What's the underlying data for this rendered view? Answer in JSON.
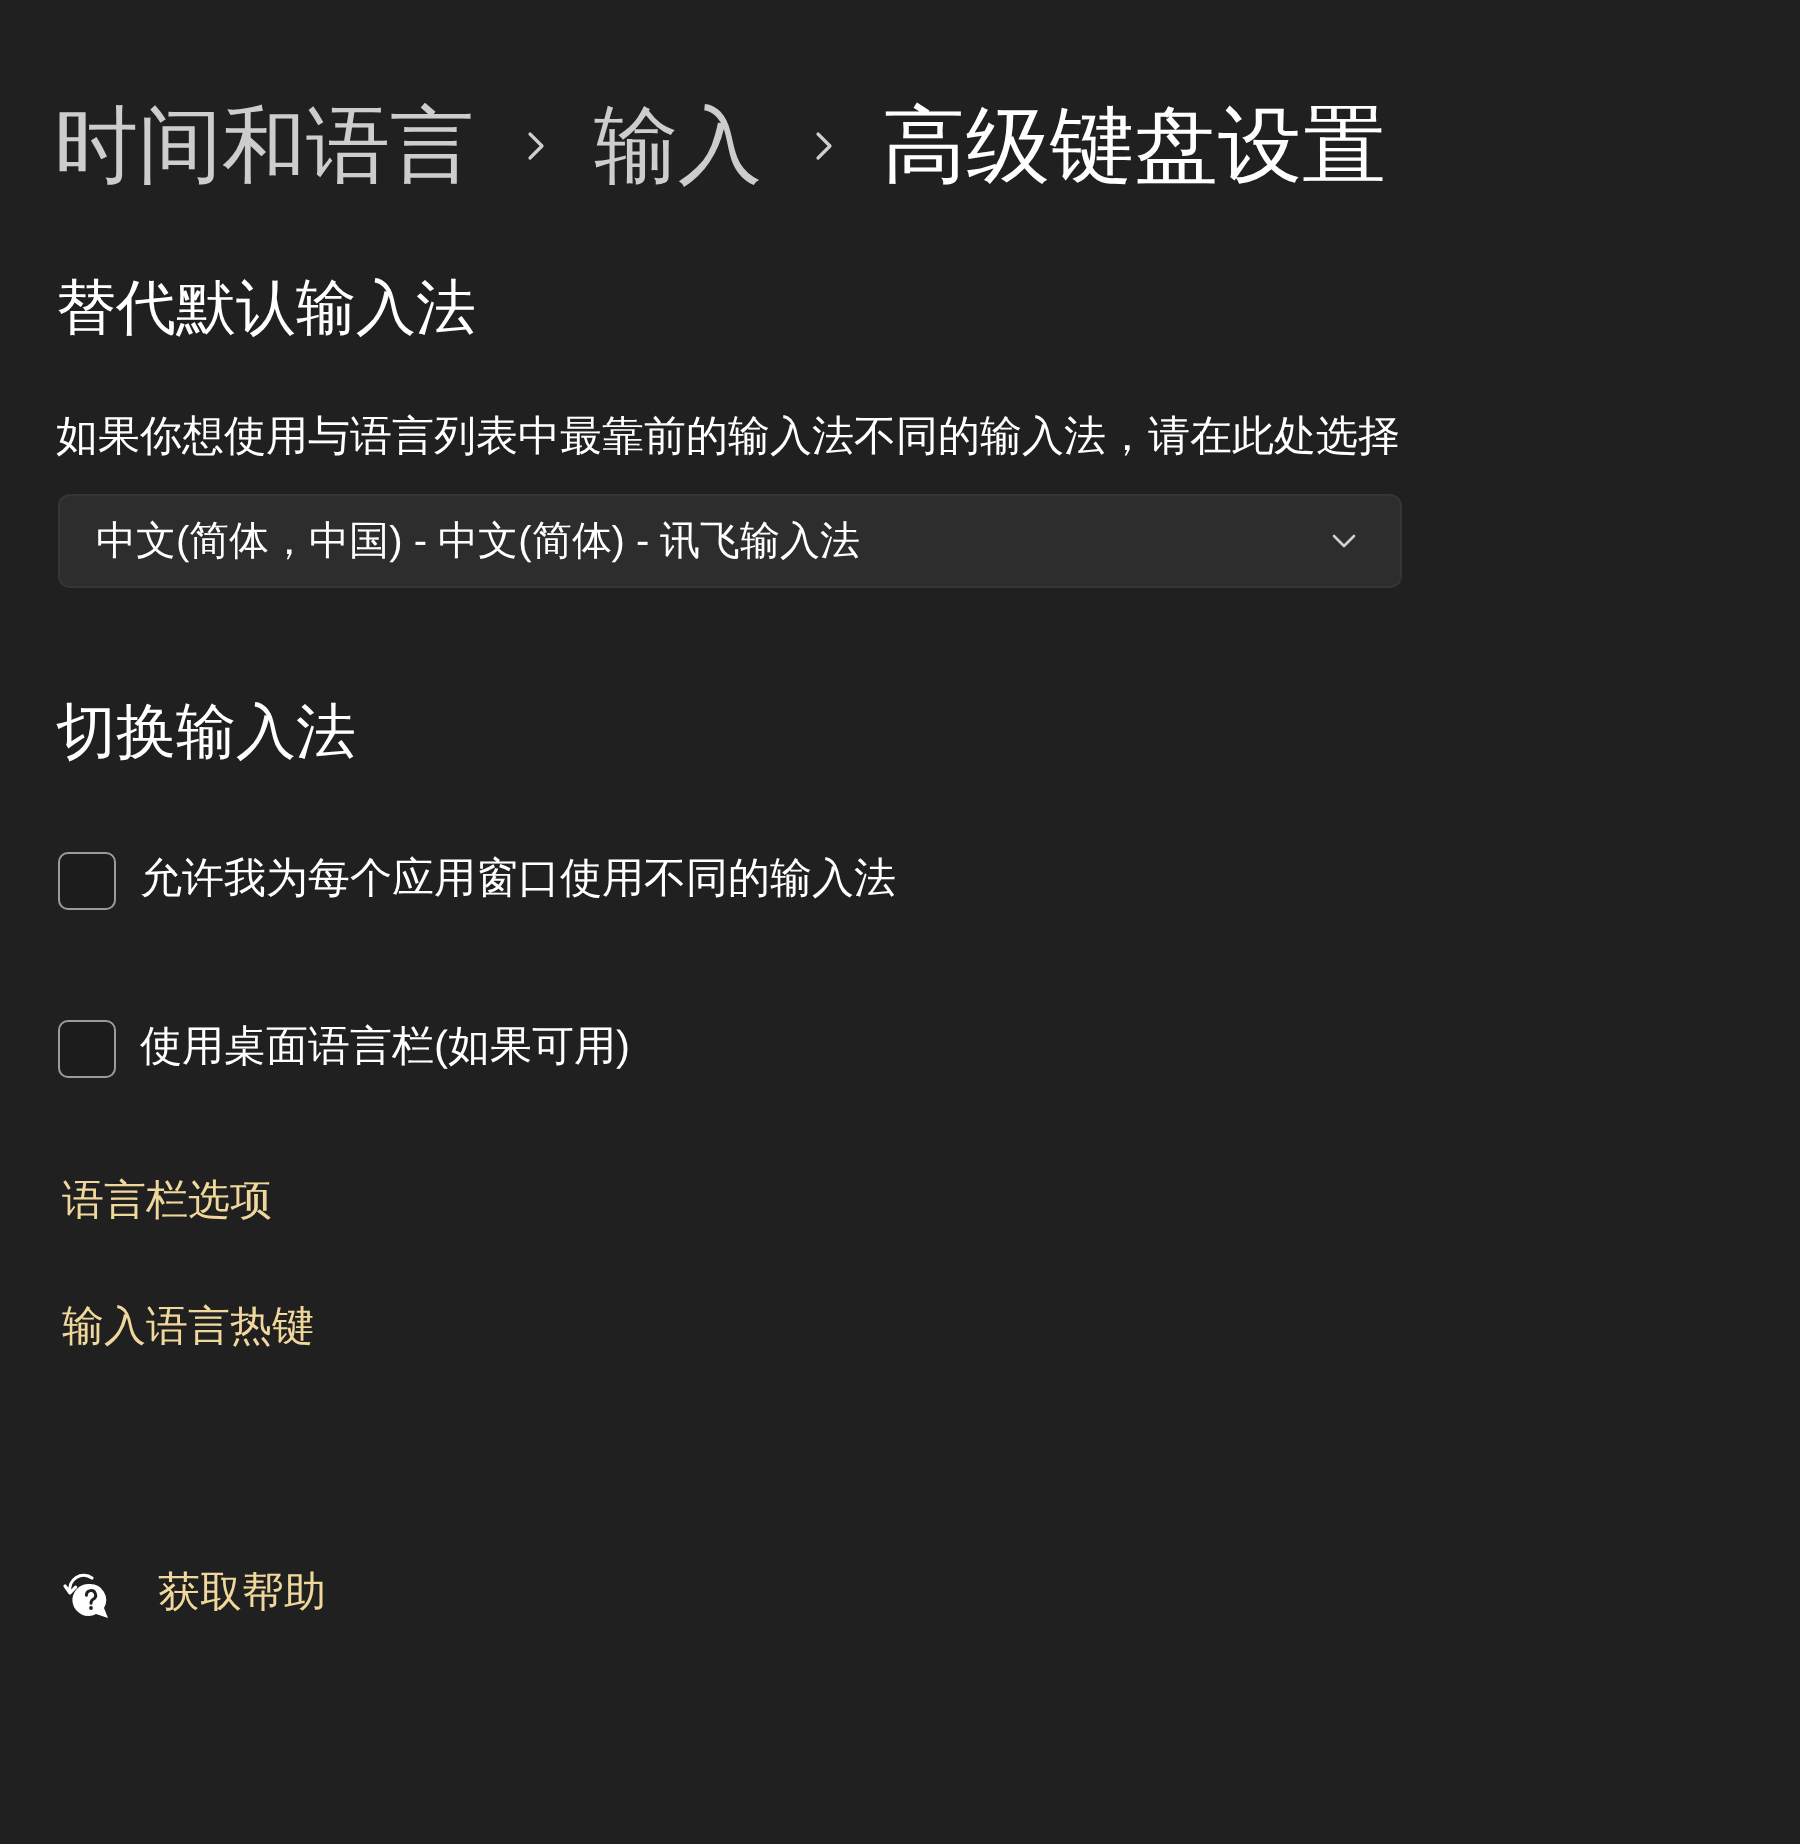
{
  "breadcrumb": [
    {
      "label": "时间和语言",
      "current": false
    },
    {
      "label": "输入",
      "current": false
    },
    {
      "label": "高级键盘设置",
      "current": true
    }
  ],
  "default_input": {
    "title": "替代默认输入法",
    "description": "如果你想使用与语言列表中最靠前的输入法不同的输入法，请在此处选择",
    "dropdown": {
      "value": "中文(简体，中国) - 中文(简体) - 讯飞输入法"
    }
  },
  "switching": {
    "title": "切换输入法",
    "options": [
      {
        "label": "允许我为每个应用窗口使用不同的输入法",
        "checked": false
      },
      {
        "label": "使用桌面语言栏(如果可用)",
        "checked": false
      }
    ],
    "links": [
      "语言栏选项",
      "输入语言热键"
    ]
  },
  "help": {
    "label": "获取帮助"
  }
}
